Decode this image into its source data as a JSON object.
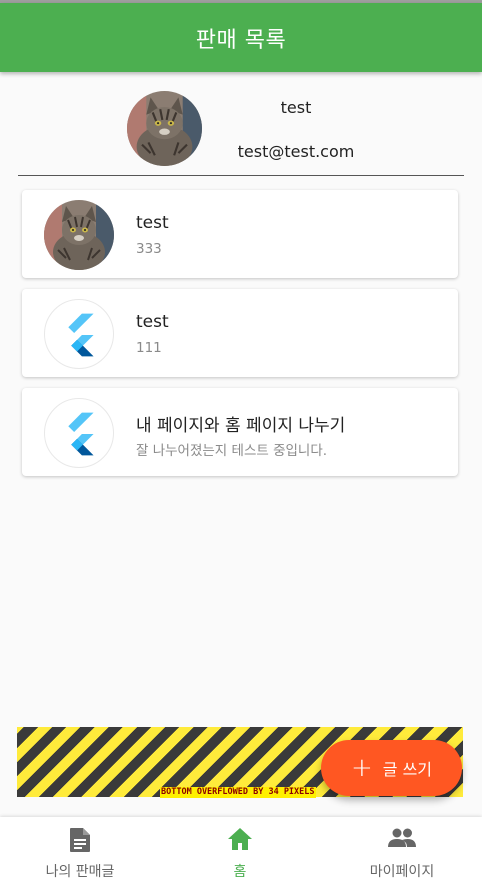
{
  "appbar": {
    "title": "판매 목록",
    "color": "#4caf50"
  },
  "profile": {
    "name": "test",
    "email": "test@test.com",
    "avatar": "cat-photo"
  },
  "posts": [
    {
      "title": "test",
      "subtitle": "333",
      "avatar": "cat-photo"
    },
    {
      "title": "test",
      "subtitle": "111",
      "avatar": "flutter-logo-icon"
    },
    {
      "title": "내 페이지와 홈 페이지 나누기",
      "subtitle": "잘 나누어졌는지 테스트 중입니다.",
      "avatar": "flutter-logo-icon"
    }
  ],
  "overflow_warning": "BOTTOM OVERFLOWED BY 34 PIXELS",
  "fab": {
    "label": "글 쓰기",
    "icon": "plus-icon",
    "color": "#ff5722"
  },
  "bottom_nav": {
    "items": [
      {
        "label": "나의 판매글",
        "icon": "document-icon"
      },
      {
        "label": "홈",
        "icon": "home-icon",
        "active": true
      },
      {
        "label": "마이페이지",
        "icon": "people-icon"
      }
    ]
  }
}
